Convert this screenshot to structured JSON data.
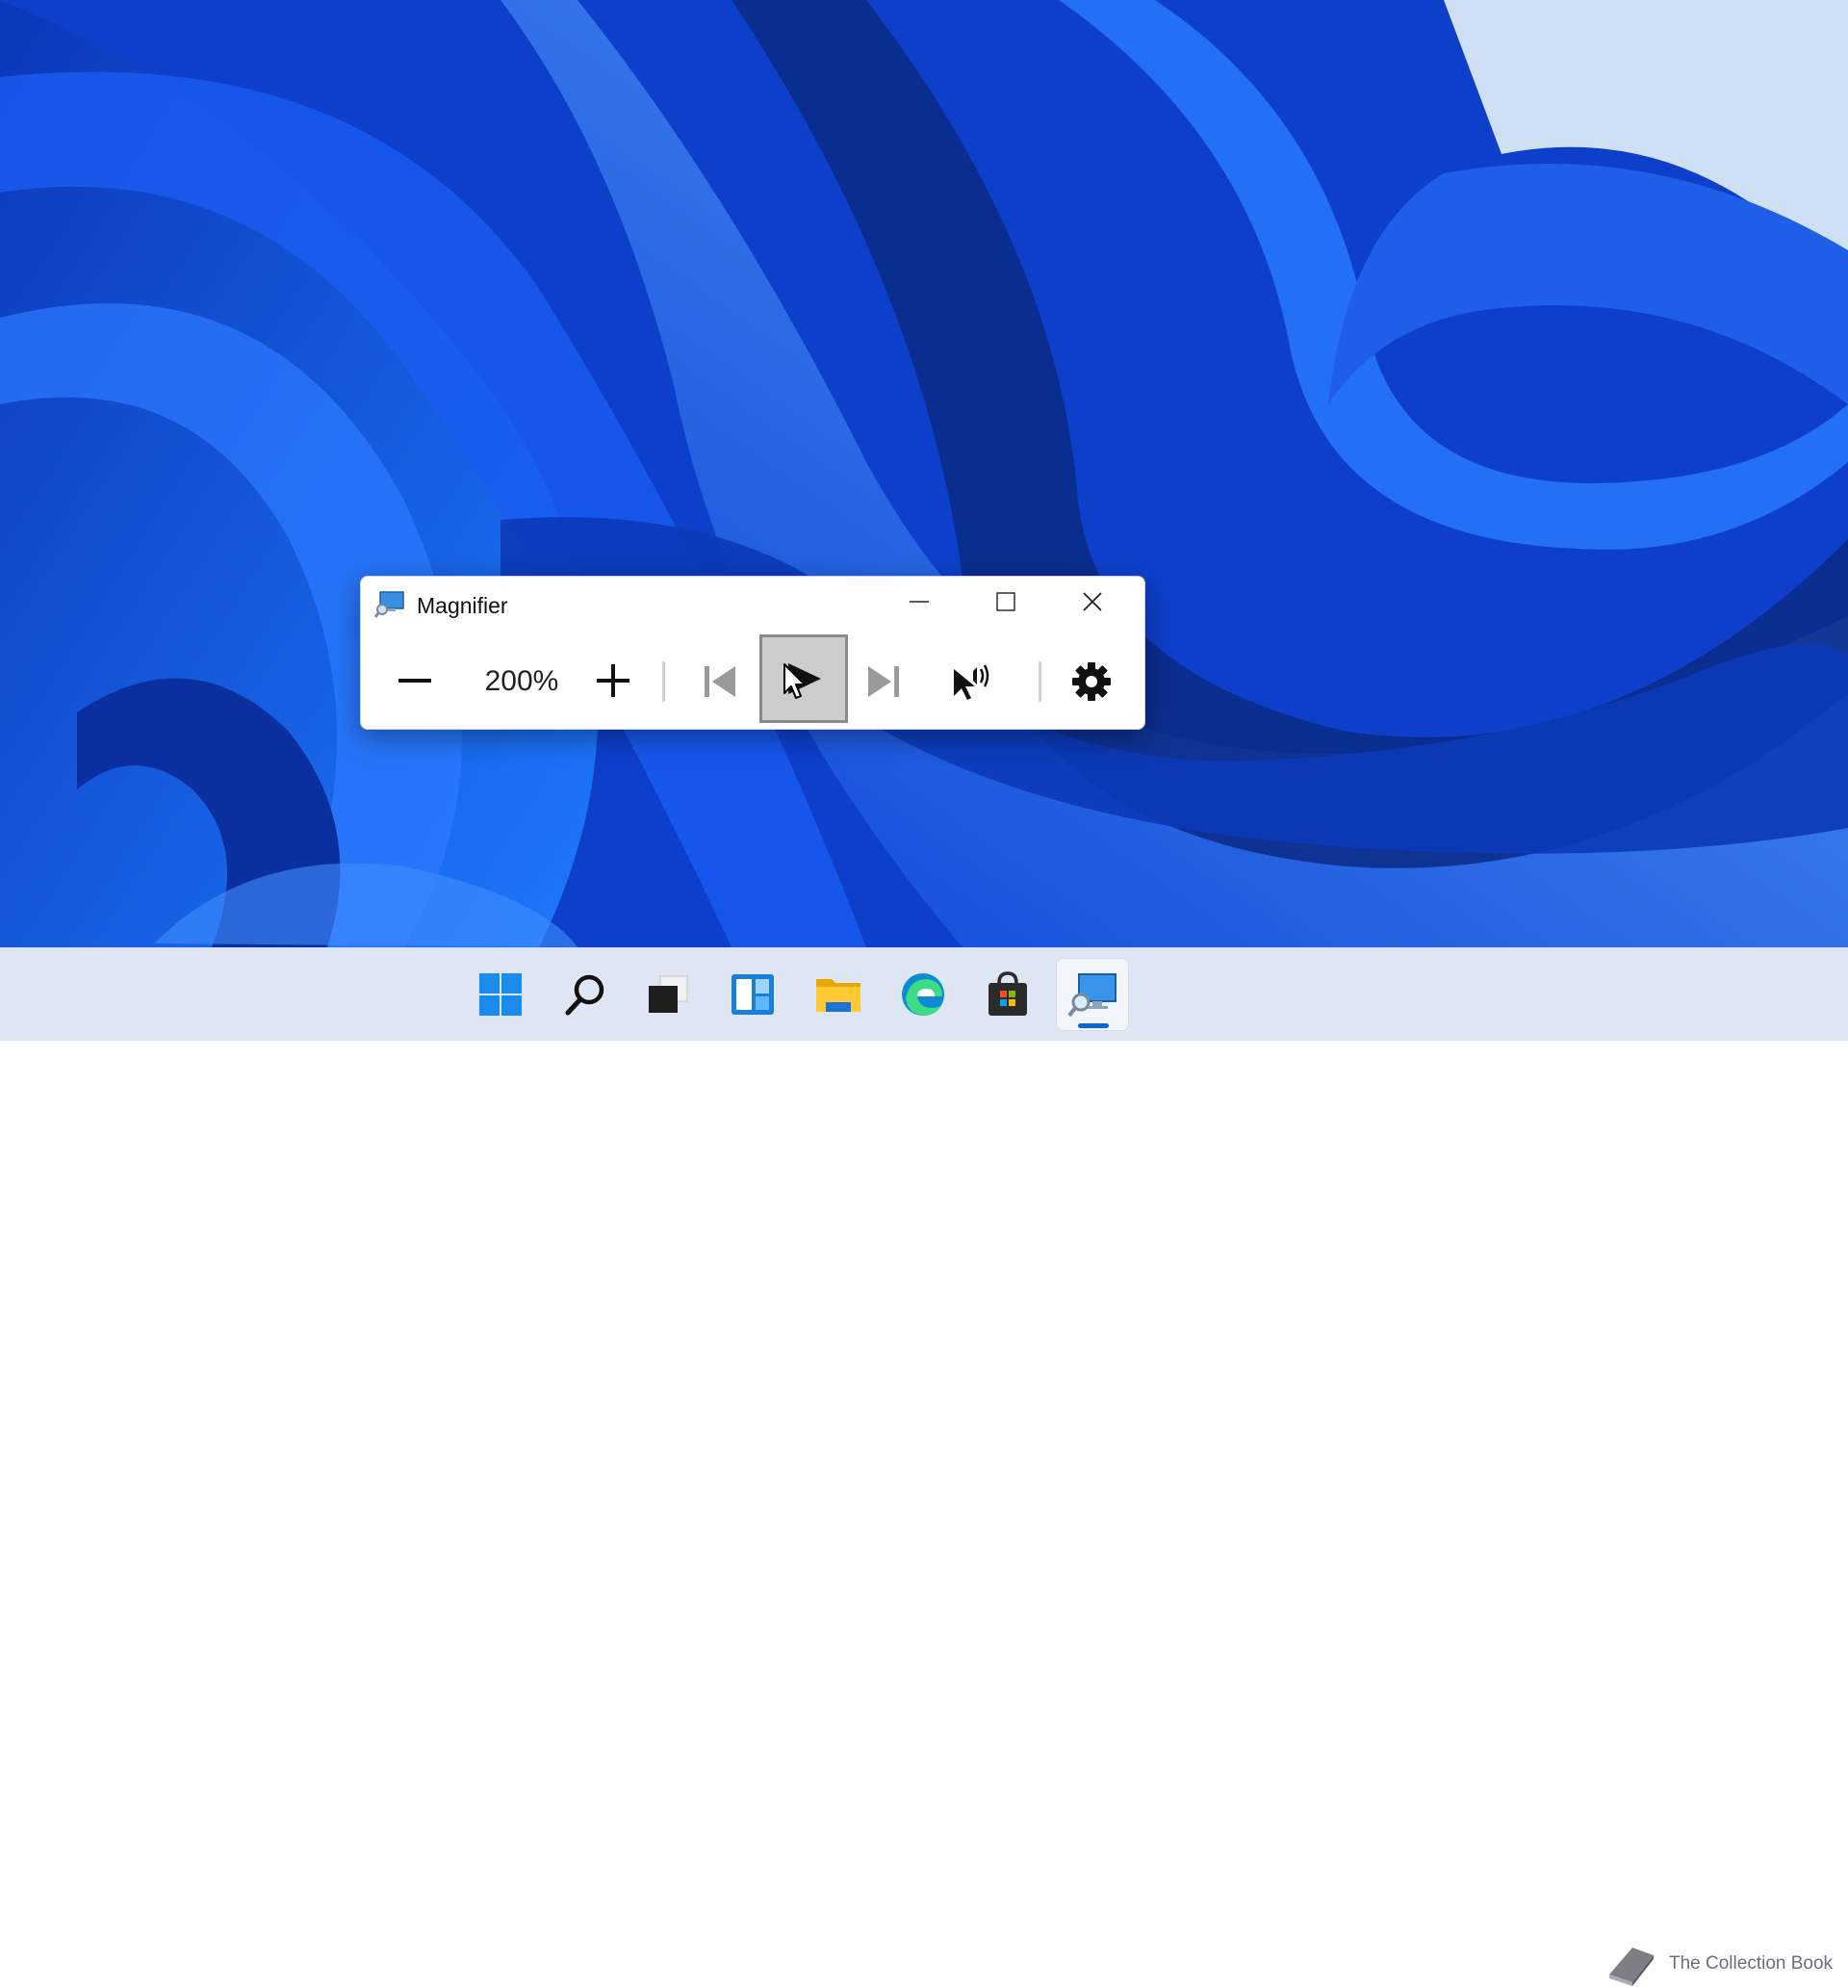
{
  "window": {
    "title": "Magnifier",
    "controls": [
      "minimize",
      "maximize",
      "close"
    ]
  },
  "toolbar": {
    "zoom_level": "200%",
    "buttons": [
      {
        "name": "zoom-out",
        "icon": "minus-icon"
      },
      {
        "name": "zoom-in",
        "icon": "plus-icon"
      },
      {
        "name": "previous",
        "icon": "previous-icon"
      },
      {
        "name": "play",
        "icon": "play-icon",
        "state": "hovered"
      },
      {
        "name": "next",
        "icon": "next-icon"
      },
      {
        "name": "read-from-here",
        "icon": "read-from-here-icon"
      },
      {
        "name": "settings",
        "icon": "gear-icon"
      }
    ]
  },
  "taskbar": {
    "items": [
      {
        "name": "start",
        "icon": "windows-logo-icon"
      },
      {
        "name": "search",
        "icon": "search-icon"
      },
      {
        "name": "task-view",
        "icon": "task-view-icon"
      },
      {
        "name": "widgets",
        "icon": "widgets-icon"
      },
      {
        "name": "file-explorer",
        "icon": "folder-icon"
      },
      {
        "name": "edge",
        "icon": "edge-icon"
      },
      {
        "name": "store",
        "icon": "store-icon"
      },
      {
        "name": "magnifier",
        "icon": "magnifier-icon",
        "active": true
      }
    ]
  },
  "watermark": {
    "text": "The Collection Book"
  },
  "colors": {
    "accent": "#0a64d6",
    "taskbar": "#dde6f2",
    "hover_button": "#cccccc"
  }
}
